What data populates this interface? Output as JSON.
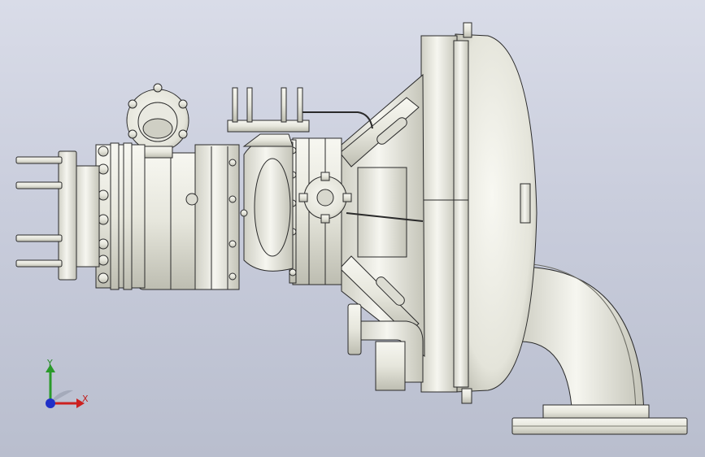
{
  "viewport": {
    "background_top": "#d9dce8",
    "background_bottom": "#b9bece",
    "model_fill": "#eeeee6",
    "model_edge": "#2a2a2a",
    "model_shadow": "#b9b9ad"
  },
  "triad": {
    "y_label": "Y",
    "x_label": "X",
    "y_color": "#2a9a2a",
    "x_color": "#cc2020",
    "z_color": "#2030c8"
  }
}
